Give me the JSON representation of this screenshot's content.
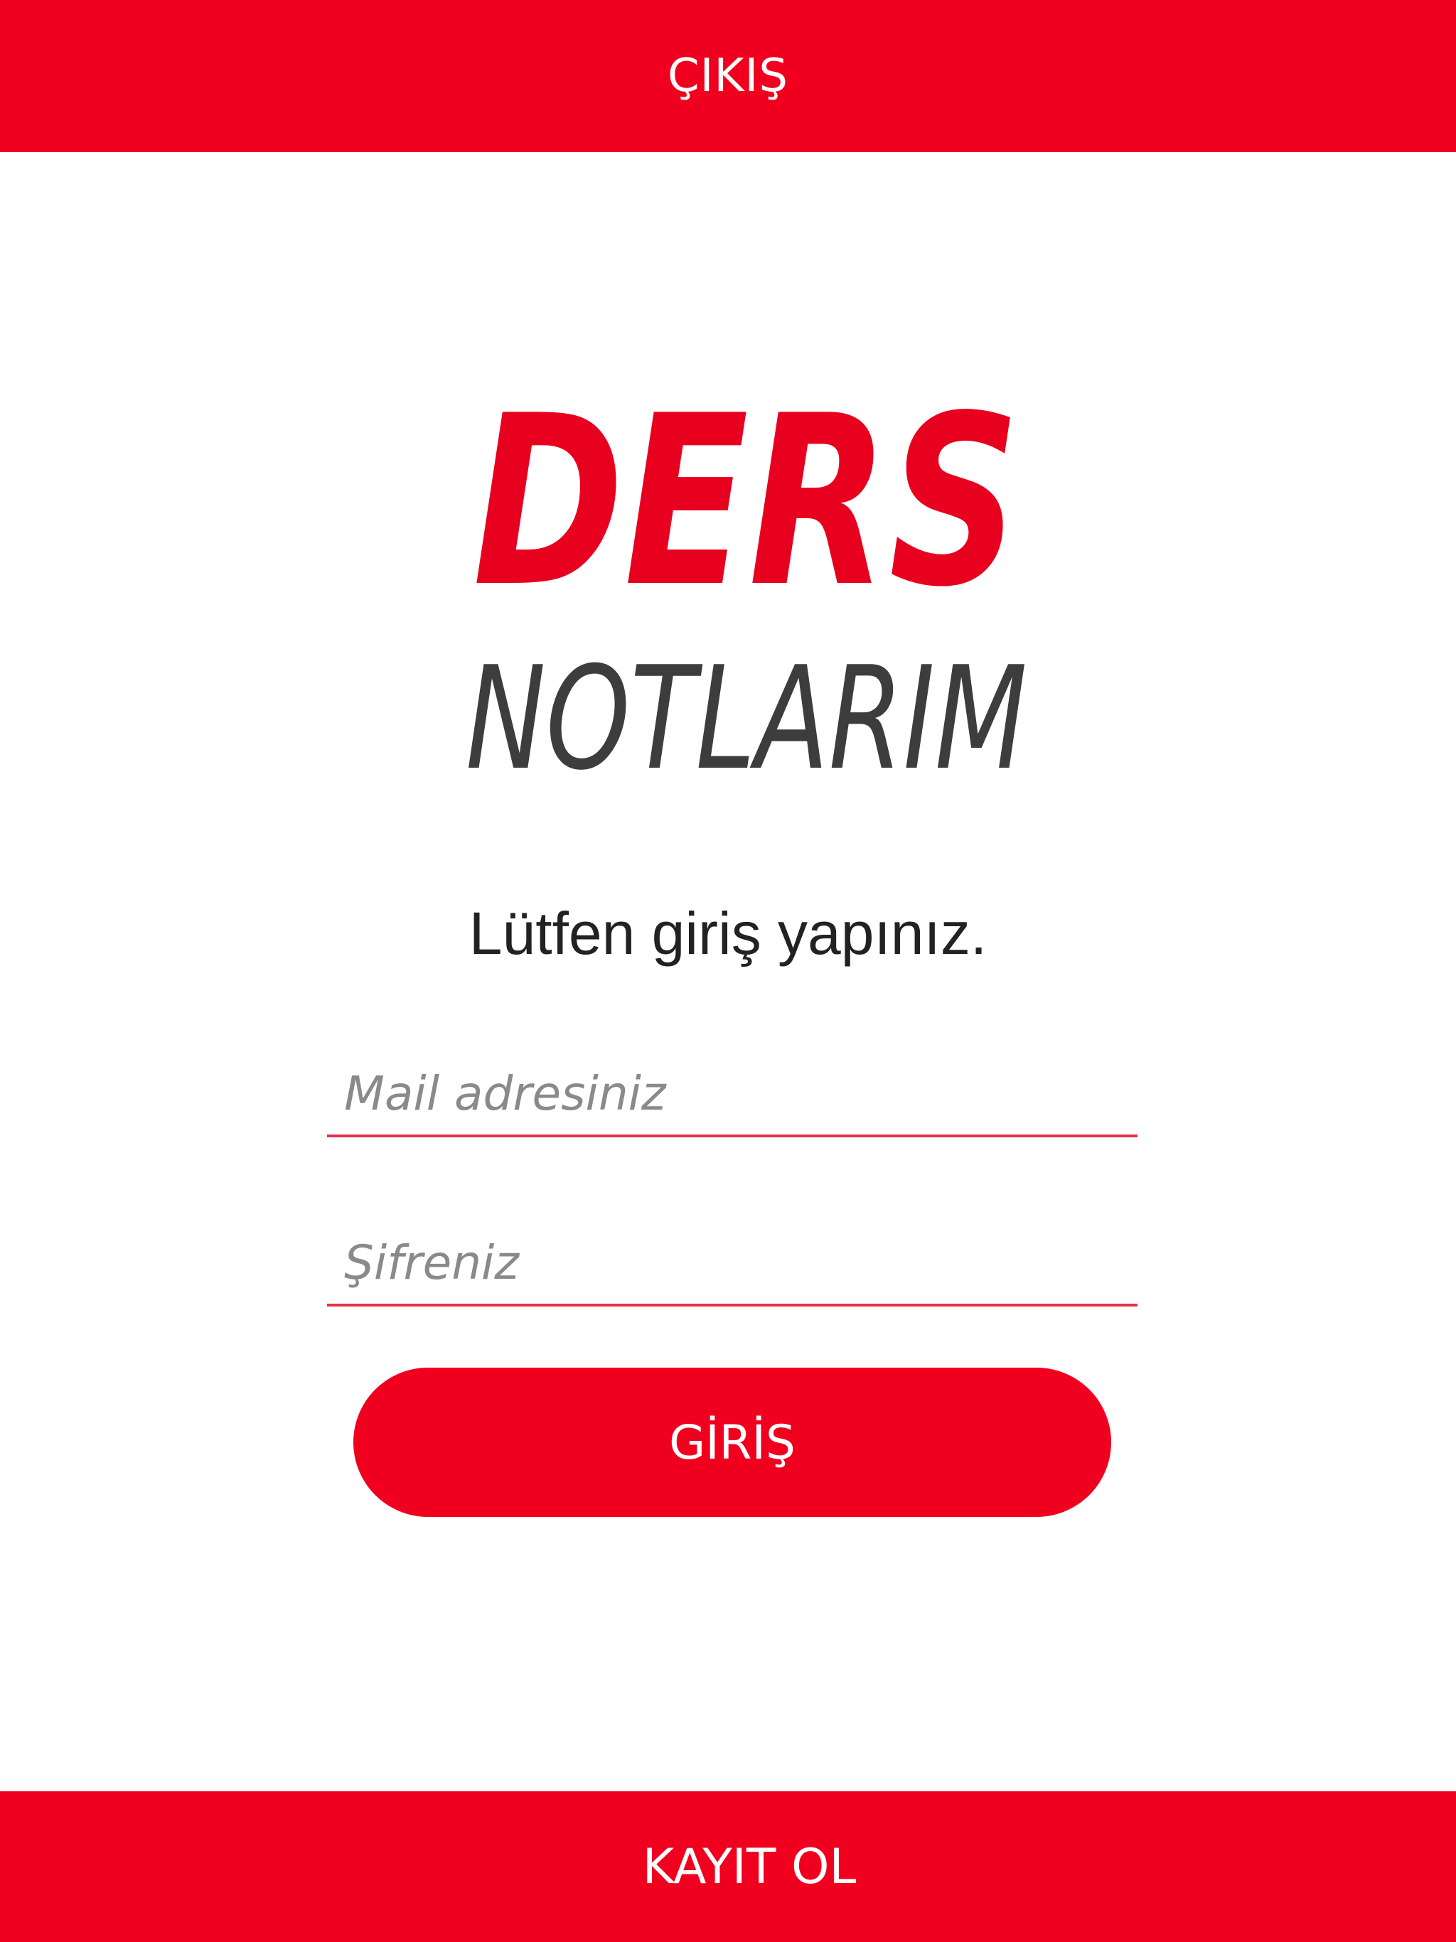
{
  "header": {
    "exit_label": "ÇIKIŞ"
  },
  "logo": {
    "line1": "DERS",
    "line2": "NOTLARIM",
    "line1_color": "#e8001f",
    "line2_color": "#3d3d3d"
  },
  "login": {
    "prompt": "Lütfen giriş yapınız.",
    "email_placeholder": "Mail adresiniz",
    "password_placeholder": "Şifreniz",
    "login_label": "GİRİŞ"
  },
  "footer": {
    "register_label": "KAYIT OL"
  },
  "colors": {
    "brand_red": "#f0001e",
    "underline": "#e8304a",
    "text_dark": "#222222",
    "placeholder_grey": "#8a8a8a"
  }
}
